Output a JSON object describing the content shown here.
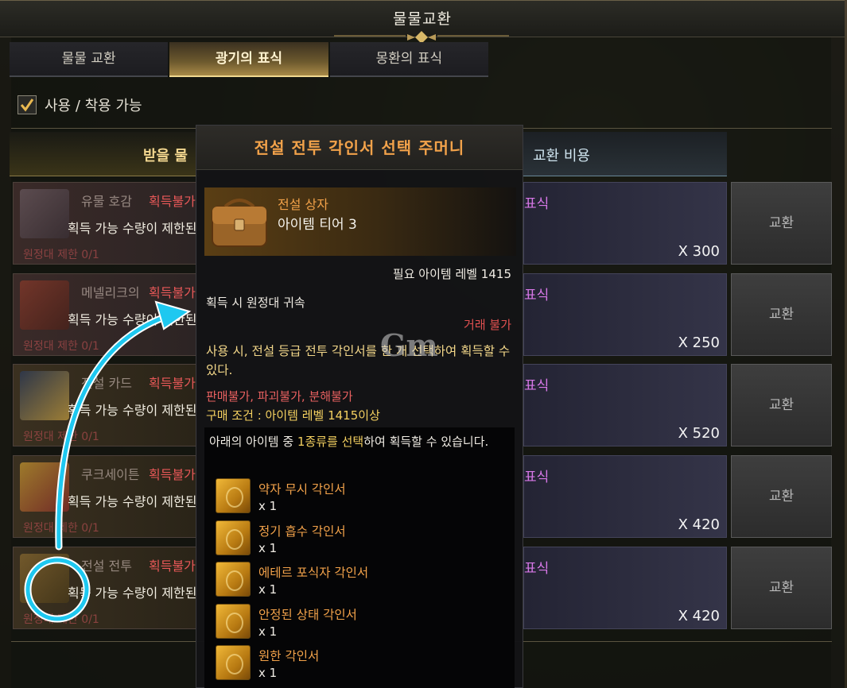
{
  "window": {
    "title": "물물교환"
  },
  "tabs": [
    {
      "label": "물물 교환",
      "active": false
    },
    {
      "label": "광기의 표식",
      "active": true
    },
    {
      "label": "몽환의 표식",
      "active": false
    }
  ],
  "filter": {
    "label": "사용 / 착용 가능",
    "checked": true
  },
  "columns": {
    "receive": "받을 물",
    "cost": "교환 비용"
  },
  "rows": [
    {
      "name": "유물 호감",
      "status": "획득불가",
      "limit_text": "획득 가능 수량이 제한된",
      "expedition": "원정대 제한 0/1",
      "cost_label": "표식",
      "cost_qty": "X 300",
      "button": "교환"
    },
    {
      "name": "메넬리크의",
      "status": "획득불가",
      "limit_text": "획득 가능 수량이 제한된",
      "expedition": "원정대 제한 0/1",
      "cost_label": "표식",
      "cost_qty": "X 250",
      "button": "교환"
    },
    {
      "name": "전설 카드",
      "status": "획득불가",
      "limit_text": "획득 가능 수량이 제한된",
      "expedition": "원정대 제한 0/1",
      "cost_label": "표식",
      "cost_qty": "X 520",
      "button": "교환"
    },
    {
      "name": "쿠크세이튼",
      "status": "획득불가",
      "limit_text": "획득 가능 수량이 제한된",
      "expedition": "원정대 제한 0/1",
      "cost_label": "표식",
      "cost_qty": "X 420",
      "button": "교환"
    },
    {
      "name": "전설 전투",
      "status": "획득불가",
      "limit_text": "획득 가능 수량이 제한된",
      "expedition": "원정대 제한 0/1",
      "cost_label": "표식",
      "cost_qty": "X 420",
      "button": "교환"
    }
  ],
  "tooltip": {
    "title": "전설 전투 각인서 선택 주머니",
    "grade": "전설 상자",
    "tier": "아이템 티어 3",
    "required_level": "필요 아이템 레벨 1415",
    "bound": "획득 시 원정대 귀속",
    "trade": "거래 불가",
    "description": "사용 시, 전설 등급 전투 각인서를 한 개 선택하여 획득할 수 있다.",
    "restrictions": "판매불가, 파괴불가, 분해불가",
    "purchase_condition": "구매 조건 : 아이템 레벨 1415이상",
    "select_prefix": "아래의 아이템 중 ",
    "select_highlight": "1종류를 선택",
    "select_suffix": "하여 획득할 수 있습니다.",
    "items": [
      {
        "name": "약자 무시 각인서",
        "qty": "x 1"
      },
      {
        "name": "정기 흡수 각인서",
        "qty": "x 1"
      },
      {
        "name": "에테르 포식자 각인서",
        "qty": "x 1"
      },
      {
        "name": "안정된 상태 각인서",
        "qty": "x 1"
      },
      {
        "name": "원한 각인서",
        "qty": "x 1"
      }
    ]
  },
  "watermark": "Gm",
  "colors": {
    "accent_gold": "#f2a24a",
    "active_tab": "#a88a48",
    "unavailable_red": "#e85858",
    "cost_purple": "#d878e8",
    "annotation_cyan": "#1ec8f0"
  }
}
